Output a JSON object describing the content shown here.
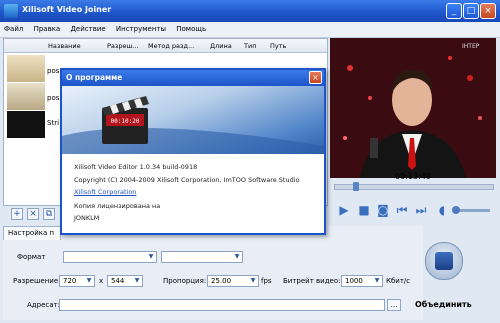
{
  "window": {
    "title": "Xilisoft Video Joiner"
  },
  "menu": [
    "Файл",
    "Правка",
    "Действие",
    "Инструменты",
    "Помощь"
  ],
  "list": {
    "columns": [
      "Название",
      "Разреш...",
      "Метод разд...",
      "Длина",
      "Тип",
      "Путь"
    ],
    "rows": [
      "pos",
      "pos",
      "Stri"
    ]
  },
  "preview": {
    "time": "00:13:49",
    "channel_logo": "ІНТЕР"
  },
  "settings": {
    "tab_label": "Настройка п",
    "format_label": "Формат",
    "resolution_label": "Разрешение:",
    "width": "720",
    "x_sep": "x",
    "height": "544",
    "framerate_label": "Пропорция:",
    "framerate_value": "25.00",
    "fps_unit": "fps",
    "bitrate_label": "Битрейт видео:",
    "bitrate_value": "1000",
    "bitrate_unit": "Кбит/с",
    "dest_label": "Адресат:",
    "browse_label": "..."
  },
  "join_label": "Объединить",
  "dialog": {
    "title": "О программе",
    "logo_text": "00:10:20",
    "version": "Xilisoft Video Editor 1.0.34  build-0918",
    "copyright": "Copyright (C) 2004-2009 Xilisoft Corporation, ImTOO Software Studio",
    "link": "Xilisoft Corporation",
    "license_label": "Копия лицензирована на",
    "license_name": "JONKLM"
  }
}
